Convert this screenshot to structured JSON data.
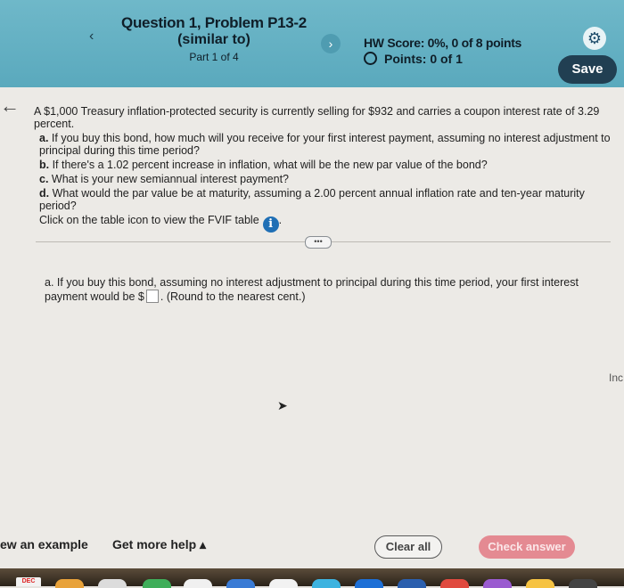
{
  "header": {
    "title": "Question 1, Problem P13-2",
    "subtitle": "(similar to)",
    "part": "Part 1 of 4",
    "prev_icon": "‹",
    "next_icon": "›",
    "hw_score": "HW Score: 0%, 0 of 8 points",
    "points": "Points: 0 of 1",
    "save_label": "Save",
    "gear_icon": "⚙"
  },
  "back_icon": "←",
  "problem": {
    "intro": "A $1,000 Treasury inflation-protected security is currently selling for $932 and carries a coupon interest rate of 3.29 percent.",
    "a_label": "a.",
    "a_text": " If you buy this bond, how much will you receive for your first interest payment, assuming no interest adjustment to principal during this time period?",
    "b_label": "b.",
    "b_text": " If there's a 1.02 percent increase in inflation, what will be the new par value of the bond?",
    "c_label": "c.",
    "c_text": " What is your new semiannual interest payment?",
    "d_label": "d.",
    "d_text": " What would the par value be at maturity, assuming a 2.00 percent annual inflation rate and ten-year maturity period?",
    "table_hint": "Click on the table icon to view the FVIF table",
    "info_icon": "i"
  },
  "more_label": "•••",
  "answer": {
    "text_before": "a. If you buy this bond, assuming no interest adjustment to principal during this time period, your first interest payment would be $",
    "text_after": ". (Round to the nearest cent.)"
  },
  "edge_text": "Inc",
  "footer": {
    "example_label": "ew an example",
    "help_label": "Get more help ▴",
    "clear_label": "Clear all",
    "check_label": "Check answer"
  },
  "dock": {
    "date_label": "DEC"
  }
}
